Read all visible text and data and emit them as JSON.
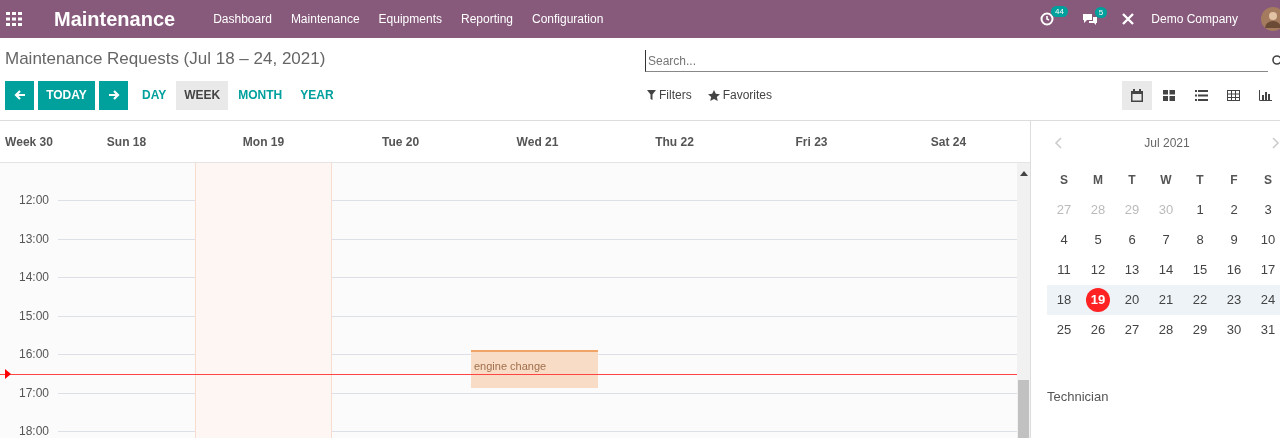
{
  "navbar": {
    "app_name": "Maintenance",
    "menu": [
      "Dashboard",
      "Maintenance",
      "Equipments",
      "Reporting",
      "Configuration"
    ],
    "activity_badge": "44",
    "messages_badge": "5",
    "company": "Demo Company"
  },
  "control_panel": {
    "title": "Maintenance Requests (Jul 18 – 24, 2021)",
    "search": {
      "placeholder": "Search..."
    },
    "today_button": "TODAY",
    "scales": [
      {
        "label": "DAY",
        "selected": false
      },
      {
        "label": "WEEK",
        "selected": true
      },
      {
        "label": "MONTH",
        "selected": false
      },
      {
        "label": "YEAR",
        "selected": false
      }
    ],
    "filters": "Filters",
    "favorites": "Favorites",
    "views": [
      {
        "kind": "calendar",
        "selected": true
      },
      {
        "kind": "kanban",
        "selected": false
      },
      {
        "kind": "list",
        "selected": false
      },
      {
        "kind": "pivot",
        "selected": false
      },
      {
        "kind": "graph",
        "selected": false
      }
    ]
  },
  "calendar": {
    "week_label": "Week 30",
    "days": [
      {
        "label": "Sun 18",
        "today": false
      },
      {
        "label": "Mon 19",
        "today": true
      },
      {
        "label": "Tue 20",
        "today": false
      },
      {
        "label": "Wed 21",
        "today": false,
        "events": [
          {
            "title": "engine change"
          }
        ]
      },
      {
        "label": "Thu 22",
        "today": false
      },
      {
        "label": "Fri 23",
        "today": false
      },
      {
        "label": "Sat 24",
        "today": false
      }
    ],
    "hours": [
      "12:00",
      "13:00",
      "14:00",
      "15:00",
      "16:00",
      "17:00",
      "18:00"
    ]
  },
  "sidebar": {
    "month": "Jul 2021",
    "weekdays": [
      "S",
      "M",
      "T",
      "W",
      "T",
      "F",
      "S"
    ],
    "weeks": [
      {
        "selected": false,
        "days": [
          {
            "label": "27",
            "muted": true,
            "today": false
          },
          {
            "label": "28",
            "muted": true,
            "today": false
          },
          {
            "label": "29",
            "muted": true,
            "today": false
          },
          {
            "label": "30",
            "muted": true,
            "today": false
          },
          {
            "label": "1",
            "muted": false,
            "today": false
          },
          {
            "label": "2",
            "muted": false,
            "today": false
          },
          {
            "label": "3",
            "muted": false,
            "today": false
          }
        ]
      },
      {
        "selected": false,
        "days": [
          {
            "label": "4",
            "muted": false,
            "today": false
          },
          {
            "label": "5",
            "muted": false,
            "today": false
          },
          {
            "label": "6",
            "muted": false,
            "today": false
          },
          {
            "label": "7",
            "muted": false,
            "today": false
          },
          {
            "label": "8",
            "muted": false,
            "today": false
          },
          {
            "label": "9",
            "muted": false,
            "today": false
          },
          {
            "label": "10",
            "muted": false,
            "today": false
          }
        ]
      },
      {
        "selected": false,
        "days": [
          {
            "label": "11",
            "muted": false,
            "today": false
          },
          {
            "label": "12",
            "muted": false,
            "today": false
          },
          {
            "label": "13",
            "muted": false,
            "today": false
          },
          {
            "label": "14",
            "muted": false,
            "today": false
          },
          {
            "label": "15",
            "muted": false,
            "today": false
          },
          {
            "label": "16",
            "muted": false,
            "today": false
          },
          {
            "label": "17",
            "muted": false,
            "today": false
          }
        ]
      },
      {
        "selected": true,
        "days": [
          {
            "label": "18",
            "muted": false,
            "today": false
          },
          {
            "label": "19",
            "muted": false,
            "today": true
          },
          {
            "label": "20",
            "muted": false,
            "today": false
          },
          {
            "label": "21",
            "muted": false,
            "today": false
          },
          {
            "label": "22",
            "muted": false,
            "today": false
          },
          {
            "label": "23",
            "muted": false,
            "today": false
          },
          {
            "label": "24",
            "muted": false,
            "today": false
          }
        ]
      },
      {
        "selected": false,
        "days": [
          {
            "label": "25",
            "muted": false,
            "today": false
          },
          {
            "label": "26",
            "muted": false,
            "today": false
          },
          {
            "label": "27",
            "muted": false,
            "today": false
          },
          {
            "label": "28",
            "muted": false,
            "today": false
          },
          {
            "label": "29",
            "muted": false,
            "today": false
          },
          {
            "label": "30",
            "muted": false,
            "today": false
          },
          {
            "label": "31",
            "muted": false,
            "today": false
          }
        ]
      }
    ],
    "filter_title": "Technician"
  }
}
